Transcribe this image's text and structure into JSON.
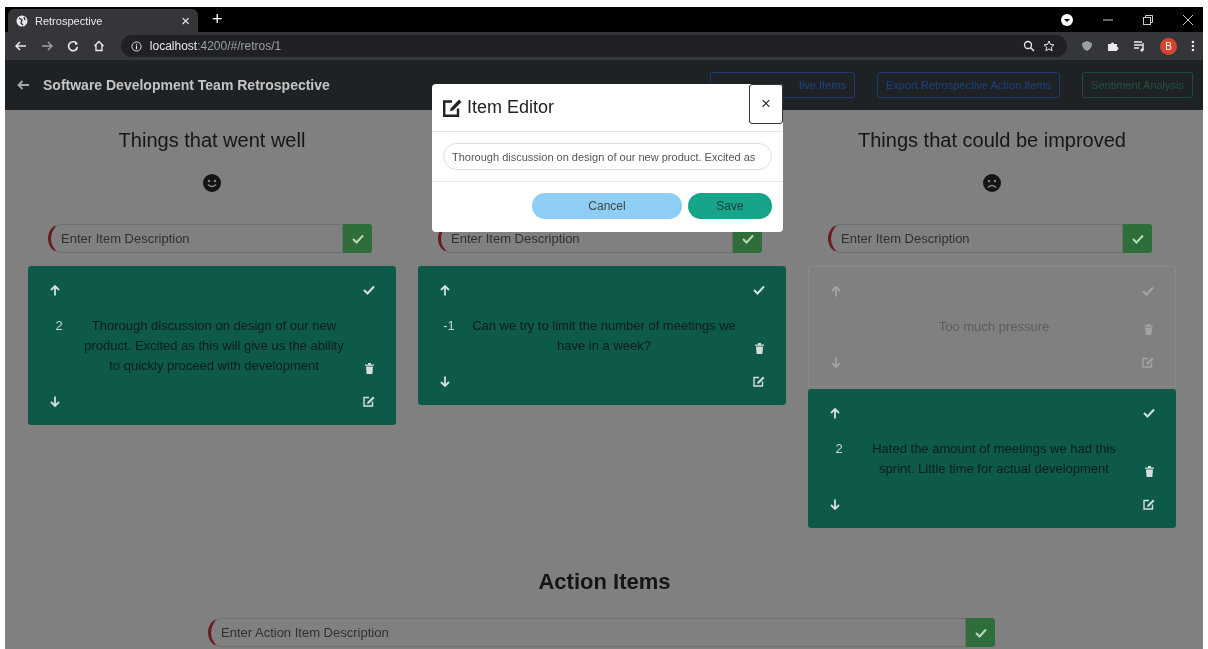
{
  "browser": {
    "tab": {
      "title": "Retrospective",
      "close": "×"
    },
    "new_tab": "+",
    "url": {
      "host": "localhost",
      "path": ":4200/#/retros/1"
    },
    "profile": "B"
  },
  "navbar": {
    "title": "Software Development Team Retrospective",
    "buttons": [
      {
        "label": "tive Items",
        "kind": "primary"
      },
      {
        "label": "Export Retrospective Action Items",
        "kind": "primary"
      },
      {
        "label": "Sentiment Analysis",
        "kind": "success"
      }
    ]
  },
  "columns": [
    {
      "title": "Things that went well",
      "kind": "happy",
      "placeholder": "Enter Item Description",
      "items": [
        {
          "votes": "2",
          "text": "Thorough discussion on design of our new product. Excited as this will give us the ability to quickly proceed with development",
          "done": false
        }
      ]
    },
    {
      "placeholder": "Enter Item Description",
      "items": [
        {
          "votes": "-1",
          "text": "Can we try to limit the number of meetings we have in a week?",
          "done": false
        }
      ]
    },
    {
      "title": "Things that could be improved",
      "kind": "sad",
      "placeholder": "Enter Item Description",
      "items": [
        {
          "text": "Too much pressure",
          "done": true
        },
        {
          "votes": "2",
          "text": "Hated the amount of meetings we had this sprint. Little time for actual development",
          "done": false
        }
      ]
    }
  ],
  "action_items": {
    "title": "Action Items",
    "placeholder": "Enter Action Item Description"
  },
  "modal": {
    "title": "Item Editor",
    "close": "×",
    "value": "Thorough discussion on design of our new product. Excited as",
    "buttons": [
      {
        "label": "Cancel",
        "kind": "secondary"
      },
      {
        "label": "Save",
        "kind": "primary"
      }
    ]
  }
}
